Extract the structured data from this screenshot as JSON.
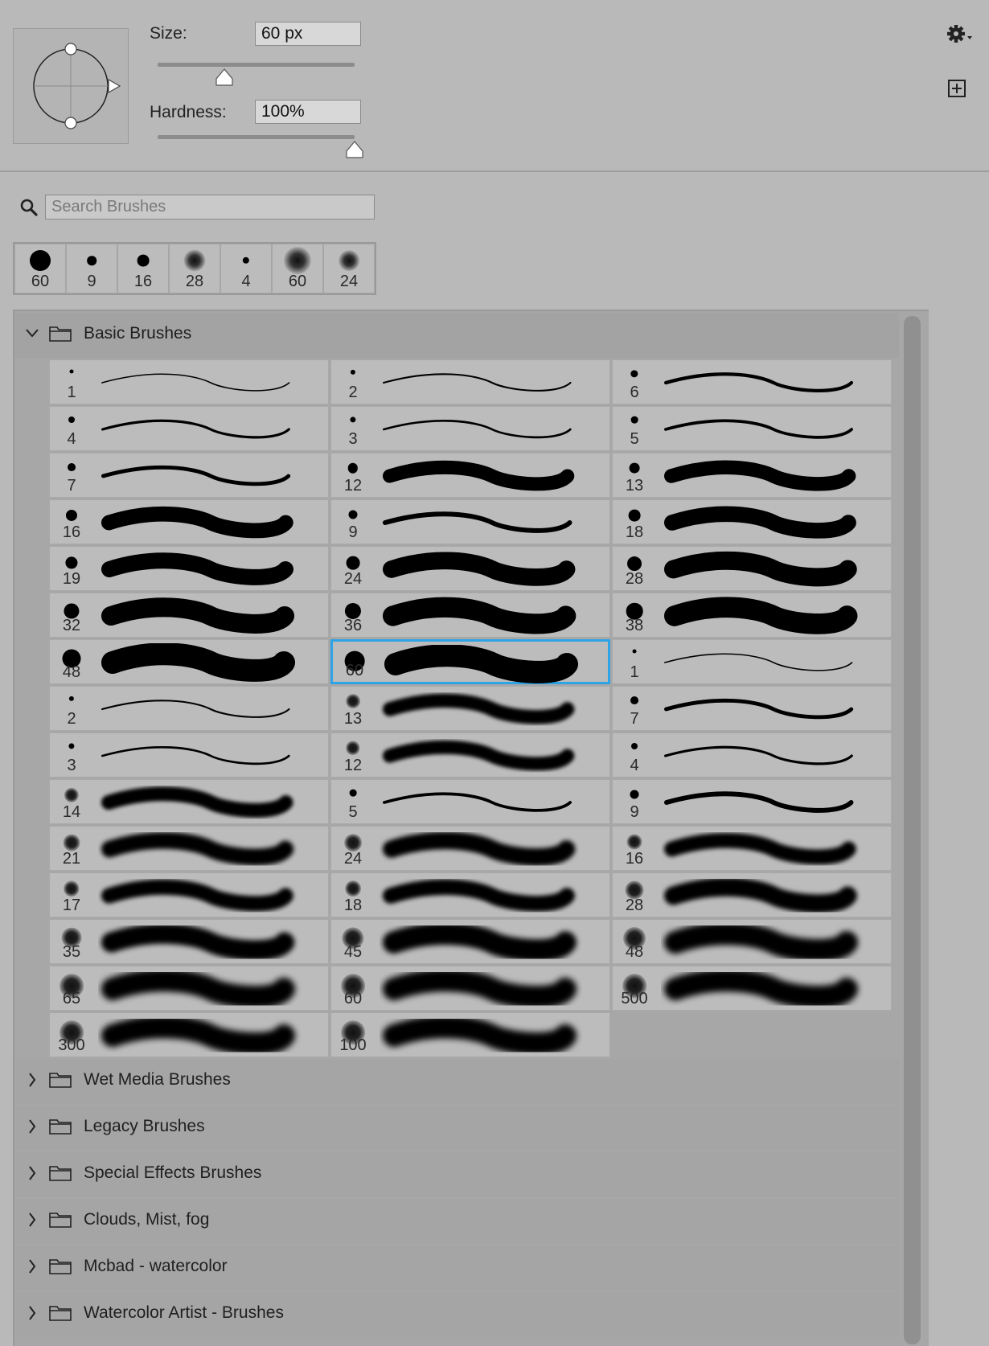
{
  "options": {
    "size_label": "Size:",
    "size_value": "60 px",
    "size_slider_fraction": 0.34,
    "hardness_label": "Hardness:",
    "hardness_value": "100%",
    "hardness_slider_fraction": 1.0
  },
  "toolbar_icons": [
    "gear-icon",
    "new-preset-icon"
  ],
  "search": {
    "placeholder": "Search Brushes",
    "value": ""
  },
  "recent_brushes": [
    {
      "size": "60",
      "hardness": "hard"
    },
    {
      "size": "9",
      "hardness": "hard"
    },
    {
      "size": "16",
      "hardness": "hard"
    },
    {
      "size": "28",
      "hardness": "soft"
    },
    {
      "size": "4",
      "hardness": "hard"
    },
    {
      "size": "60",
      "hardness": "soft"
    },
    {
      "size": "24",
      "hardness": "soft"
    }
  ],
  "groups": [
    {
      "name": "Basic Brushes",
      "expanded": true,
      "brushes": [
        {
          "size": "1",
          "soft": false
        },
        {
          "size": "2",
          "soft": false
        },
        {
          "size": "6",
          "soft": false
        },
        {
          "size": "4",
          "soft": false
        },
        {
          "size": "3",
          "soft": false
        },
        {
          "size": "5",
          "soft": false
        },
        {
          "size": "7",
          "soft": false
        },
        {
          "size": "12",
          "soft": false
        },
        {
          "size": "13",
          "soft": false
        },
        {
          "size": "16",
          "soft": false
        },
        {
          "size": "9",
          "soft": false
        },
        {
          "size": "18",
          "soft": false
        },
        {
          "size": "19",
          "soft": false
        },
        {
          "size": "24",
          "soft": false
        },
        {
          "size": "28",
          "soft": false
        },
        {
          "size": "32",
          "soft": false
        },
        {
          "size": "36",
          "soft": false
        },
        {
          "size": "38",
          "soft": false
        },
        {
          "size": "48",
          "soft": false
        },
        {
          "size": "60",
          "soft": false,
          "selected": true
        },
        {
          "size": "1",
          "soft": false
        },
        {
          "size": "2",
          "soft": false
        },
        {
          "size": "13",
          "soft": true
        },
        {
          "size": "7",
          "soft": false
        },
        {
          "size": "3",
          "soft": false
        },
        {
          "size": "12",
          "soft": true
        },
        {
          "size": "4",
          "soft": false
        },
        {
          "size": "14",
          "soft": true
        },
        {
          "size": "5",
          "soft": false
        },
        {
          "size": "9",
          "soft": false
        },
        {
          "size": "21",
          "soft": true
        },
        {
          "size": "24",
          "soft": true
        },
        {
          "size": "16",
          "soft": true
        },
        {
          "size": "17",
          "soft": true
        },
        {
          "size": "18",
          "soft": true
        },
        {
          "size": "28",
          "soft": true
        },
        {
          "size": "35",
          "soft": true
        },
        {
          "size": "45",
          "soft": true
        },
        {
          "size": "48",
          "soft": true
        },
        {
          "size": "65",
          "soft": true
        },
        {
          "size": "60",
          "soft": true
        },
        {
          "size": "500",
          "soft": true
        },
        {
          "size": "300",
          "soft": true
        },
        {
          "size": "100",
          "soft": true
        }
      ]
    },
    {
      "name": "Wet Media Brushes",
      "expanded": false
    },
    {
      "name": "Legacy Brushes",
      "expanded": false
    },
    {
      "name": "Special Effects Brushes",
      "expanded": false
    },
    {
      "name": "Clouds, Mist, fog",
      "expanded": false
    },
    {
      "name": "Mcbad - watercolor",
      "expanded": false
    },
    {
      "name": "Watercolor Artist - Brushes",
      "expanded": false
    }
  ]
}
